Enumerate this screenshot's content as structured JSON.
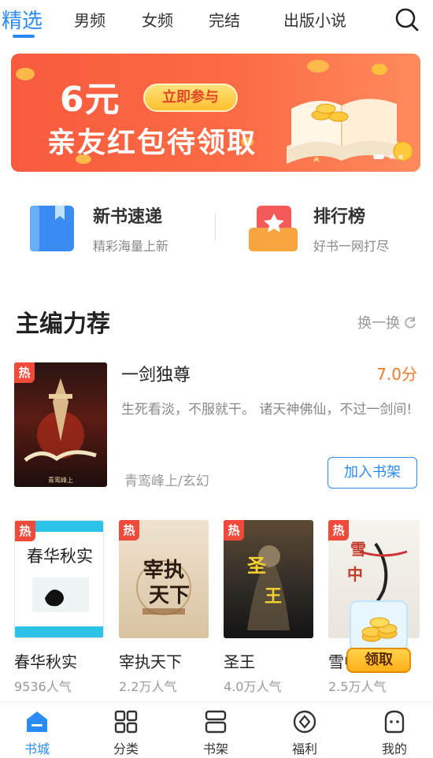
{
  "tabs": [
    {
      "label": "精选",
      "active": true
    },
    {
      "label": "男频"
    },
    {
      "label": "女频"
    },
    {
      "label": "完结"
    },
    {
      "label": "出版小说"
    }
  ],
  "search": {
    "icon": "search-icon"
  },
  "banner": {
    "amount": "6元",
    "cta": "立即参与",
    "title": "亲友红包待领取",
    "slides": 3,
    "active_slide": 1
  },
  "entries": [
    {
      "title": "新书速递",
      "subtitle": "精彩海量上新",
      "icon": "book-icon"
    },
    {
      "title": "排行榜",
      "subtitle": "好书一网打尽",
      "icon": "trophy-icon"
    }
  ],
  "section": {
    "title": "主编力荐",
    "refresh_label": "换一换"
  },
  "featured": {
    "badge": "热",
    "title": "一剑独尊",
    "score": "7.0分",
    "description": "生死看淡，不服就干。 诸天神佛仙，不过一剑间!",
    "meta": "青鸾峰上/玄幻",
    "add_label": "加入书架"
  },
  "books": [
    {
      "badge": "热",
      "title": "春华秋实",
      "popularity": "9536人气"
    },
    {
      "badge": "热",
      "title": "宰执天下",
      "popularity": "2.2万人气"
    },
    {
      "badge": "热",
      "title": "圣王",
      "popularity": "4.0万人气"
    },
    {
      "badge": "热",
      "title": "雪中悍刀行",
      "popularity": "2.5万人气"
    }
  ],
  "reward": {
    "label": "领取"
  },
  "nav": [
    {
      "label": "书城",
      "icon": "home-icon",
      "active": true
    },
    {
      "label": "分类",
      "icon": "grid-icon"
    },
    {
      "label": "书架",
      "icon": "shelf-icon"
    },
    {
      "label": "福利",
      "icon": "coin-icon"
    },
    {
      "label": "我的",
      "icon": "profile-icon"
    }
  ],
  "colors": {
    "accent": "#2a8cf3",
    "banner": "#f85a3d",
    "score": "#f07a2a",
    "hot": "#f04b3a"
  }
}
